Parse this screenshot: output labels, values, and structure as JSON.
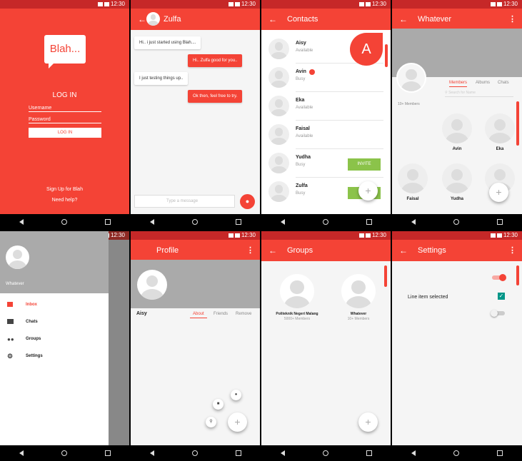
{
  "status": {
    "time": "12:30"
  },
  "login": {
    "logo": "Blah...",
    "title": "LOG IN",
    "username": "Username",
    "password": "Password",
    "button": "LOG IN",
    "signup": "Sign Up for Blah",
    "help": "Need help?"
  },
  "chat": {
    "title": "Zulfa",
    "messages": [
      {
        "text": "Hi.. i just started using Blah....",
        "side": "in"
      },
      {
        "text": "Hi.. Zulfa good for you..",
        "side": "out"
      },
      {
        "text": "I just testing things up..",
        "side": "in"
      },
      {
        "text": "Ok then, feel free to try.",
        "side": "out"
      }
    ],
    "placeholder": "Type a message"
  },
  "contacts": {
    "title": "Contacts",
    "index_letter": "A",
    "invite": "INVITE",
    "items": [
      {
        "name": "Aisy",
        "status": "Available"
      },
      {
        "name": "Avin",
        "status": "Busy"
      },
      {
        "name": "Eka",
        "status": "Available"
      },
      {
        "name": "Faisal",
        "status": "Available"
      },
      {
        "name": "Yudha",
        "status": "Busy"
      },
      {
        "name": "Zulfa",
        "status": "Busy"
      }
    ]
  },
  "group": {
    "title": "Whatever",
    "tabs": [
      "Members",
      "Albums",
      "Chats"
    ],
    "search": "Search for Name",
    "count": "10+ Members",
    "members": [
      "Avin",
      "Eka",
      "Faisal",
      "Yudha"
    ]
  },
  "drawer": {
    "name": "Whatever",
    "items": [
      "Inbox",
      "Chats",
      "Groups",
      "Settings"
    ]
  },
  "profile": {
    "title": "Profile",
    "name": "Aisy",
    "tabs": [
      "About",
      "Friends",
      "Remove"
    ]
  },
  "groups": {
    "title": "Groups",
    "items": [
      {
        "name": "Politeknik Negeri Malang",
        "count": "5000+ Members"
      },
      {
        "name": "Whatever",
        "count": "10+ Members"
      }
    ]
  },
  "settings": {
    "title": "Settings",
    "item": "Line item selected"
  },
  "colors": {
    "primary": "#f44336",
    "dark": "#c62828",
    "accent": "#8bc34a"
  }
}
